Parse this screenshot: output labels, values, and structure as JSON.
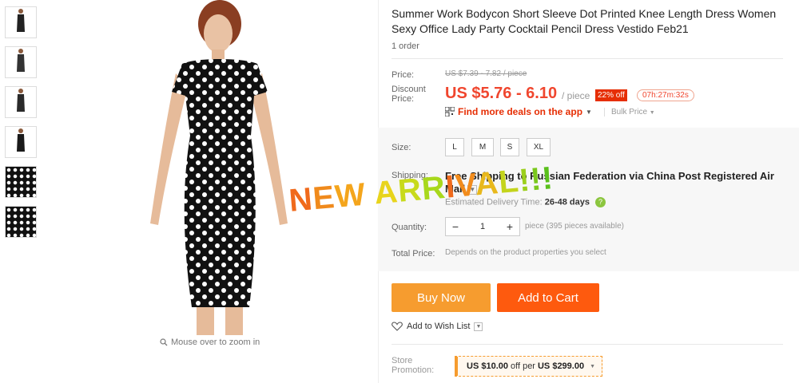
{
  "product": {
    "title": "Summer Work Bodycon Short Sleeve Dot Printed Knee Length Dress Women Sexy Office Lady Party Cocktail Pencil Dress Vestido Feb21",
    "orders": "1 order"
  },
  "gallery": {
    "zoom_hint": "Mouse over to zoom in",
    "thumbnail_count": 6
  },
  "price": {
    "label": "Price:",
    "original": "US $7.39 - 7.82 / piece",
    "discount_label_1": "Discount",
    "discount_label_2": "Price:",
    "discount": "US $5.76 - 6.10",
    "unit": "/ piece",
    "off_badge": "22% off",
    "timer": "07h:27m:32s",
    "app_deal": "Find more deals on the app",
    "bulk": "Bulk Price"
  },
  "size": {
    "label": "Size:",
    "options": [
      "L",
      "M",
      "S",
      "XL"
    ]
  },
  "shipping": {
    "label": "Shipping:",
    "text": "Free Shipping to Russian Federation via China Post Registered Air Mail",
    "delivery_label": "Estimated Delivery Time:",
    "delivery_value": "26-48 days"
  },
  "quantity": {
    "label": "Quantity:",
    "value": "1",
    "info": "piece (395 pieces available)"
  },
  "total": {
    "label": "Total Price:",
    "value": "Depends on the product properties you select"
  },
  "actions": {
    "buy_now": "Buy Now",
    "add_to_cart": "Add to Cart",
    "wishlist": "Add to Wish List"
  },
  "promotion": {
    "label_1": "Store",
    "label_2": "Promotion:",
    "amount": "US $10.00",
    "middle": "off per",
    "threshold": "US $299.00"
  },
  "overlay": {
    "text": "NEW ARRIVAL!!!"
  },
  "colors": {
    "accent": "#f0462e",
    "buy": "#f69c2f",
    "cart": "#fe5a0e"
  }
}
